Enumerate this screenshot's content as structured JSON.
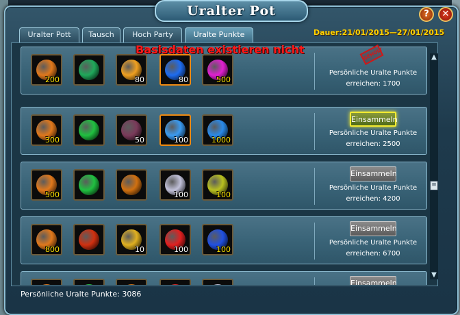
{
  "window": {
    "title": "Uralter Pot"
  },
  "controls": {
    "help": "?",
    "close": "✕"
  },
  "tabs": [
    {
      "label": "Uralter Pott"
    },
    {
      "label": "Tausch"
    },
    {
      "label": "Hoch Party"
    },
    {
      "label": "Uralte Punkte"
    }
  ],
  "duration": "Dauer:21/01/2015—27/01/2015",
  "error": "Basisdaten existieren nicht",
  "rows": [
    {
      "items": [
        {
          "icon": "coin-icon",
          "count": "200",
          "color": "#e0781c"
        },
        {
          "icon": "green-crystal-icon",
          "count": "",
          "color": "#1fa85a"
        },
        {
          "icon": "gold-swirl-icon",
          "count": "80",
          "color": "#f0a020"
        },
        {
          "icon": "blue-gem-icon",
          "count": "80",
          "color": "#1e6cf0"
        },
        {
          "icon": "pink-flame-icon",
          "count": "500",
          "color": "#e020d0"
        }
      ],
      "button": "",
      "stamp": "GEHOLT",
      "req_line1": "Persönliche Uralte Punkte",
      "req_line2": "erreichen: 1700"
    },
    {
      "items": [
        {
          "icon": "coin-icon",
          "count": "300",
          "color": "#e0781c"
        },
        {
          "icon": "green-gem-icon",
          "count": "",
          "color": "#20c040"
        },
        {
          "icon": "gift-box-icon",
          "count": "50",
          "color": "#7a3a5a"
        },
        {
          "icon": "blue-ice-icon",
          "count": "100",
          "color": "#3a9af0"
        },
        {
          "icon": "blue-orb-icon",
          "count": "1000",
          "color": "#2a8ae8"
        }
      ],
      "button": "Einsammeln",
      "stamp": "",
      "req_line1": "Persönliche Uralte Punkte",
      "req_line2": "erreichen: 2500"
    },
    {
      "items": [
        {
          "icon": "coin-icon",
          "count": "500",
          "color": "#e0781c"
        },
        {
          "icon": "green-gem-icon",
          "count": "",
          "color": "#20c040"
        },
        {
          "icon": "orange-orb-icon",
          "count": "",
          "color": "#d07010"
        },
        {
          "icon": "feather-icon",
          "count": "100",
          "color": "#c0c0d8"
        },
        {
          "icon": "yellow-orb-icon",
          "count": "100",
          "color": "#b8c020"
        }
      ],
      "button": "Einsammeln",
      "stamp": "",
      "req_line1": "Persönliche Uralte Punkte",
      "req_line2": "erreichen: 4200"
    },
    {
      "items": [
        {
          "icon": "coin-icon",
          "count": "800",
          "color": "#e0781c"
        },
        {
          "icon": "red-orb-icon",
          "count": "",
          "color": "#d03010"
        },
        {
          "icon": "key-icon",
          "count": "10",
          "color": "#e0b020"
        },
        {
          "icon": "red-crystal-icon",
          "count": "100",
          "color": "#e02020"
        },
        {
          "icon": "blue-sphere-icon",
          "count": "100",
          "color": "#2050e0"
        }
      ],
      "button": "Einsammeln",
      "stamp": "",
      "req_line1": "Persönliche Uralte Punkte",
      "req_line2": "erreichen: 6700"
    },
    {
      "items": [
        {
          "icon": "coin-icon",
          "count": "",
          "color": "#e0781c"
        },
        {
          "icon": "green-crystal-icon",
          "count": "",
          "color": "#20c040"
        },
        {
          "icon": "orange-orb-icon",
          "count": "",
          "color": "#d07010"
        },
        {
          "icon": "red-crystal-icon",
          "count": "",
          "color": "#e02020"
        },
        {
          "icon": "feather-icon",
          "count": "",
          "color": "#c0c0d8"
        }
      ],
      "button": "Einsammeln",
      "stamp": "",
      "req_line1": "",
      "req_line2": ""
    }
  ],
  "footer": "Persönliche Uralte Punkte: 3086"
}
